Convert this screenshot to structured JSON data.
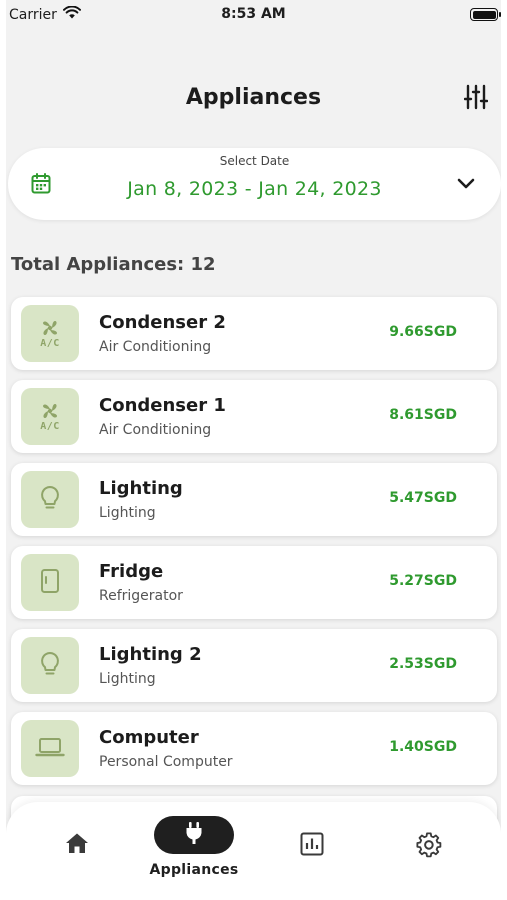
{
  "status_bar": {
    "carrier": "Carrier",
    "time": "8:53 AM"
  },
  "header": {
    "title": "Appliances"
  },
  "date_filter": {
    "label": "Select Date",
    "range": "Jan 8, 2023 - Jan 24, 2023"
  },
  "summary": {
    "total": "Total Appliances: 12"
  },
  "appliances": [
    {
      "name": "Condenser 2",
      "category": "Air Conditioning",
      "cost": "9.66SGD",
      "icon": "air-conditioner-icon"
    },
    {
      "name": "Condenser 1",
      "category": "Air Conditioning",
      "cost": "8.61SGD",
      "icon": "air-conditioner-icon"
    },
    {
      "name": "Lighting",
      "category": "Lighting",
      "cost": "5.47SGD",
      "icon": "lightbulb-icon"
    },
    {
      "name": "Fridge",
      "category": "Refrigerator",
      "cost": "5.27SGD",
      "icon": "fridge-icon"
    },
    {
      "name": "Lighting 2",
      "category": "Lighting",
      "cost": "2.53SGD",
      "icon": "lightbulb-icon"
    },
    {
      "name": "Computer",
      "category": "Personal Computer",
      "cost": "1.40SGD",
      "icon": "laptop-icon"
    }
  ],
  "ac_icon_text": {
    "line1": "A/C"
  },
  "bottom_nav": {
    "active_label": "Appliances"
  },
  "colors": {
    "accent": "#2f9a2f",
    "icon_bg": "#d9e5c6",
    "nav_active": "#1f1f1f"
  }
}
